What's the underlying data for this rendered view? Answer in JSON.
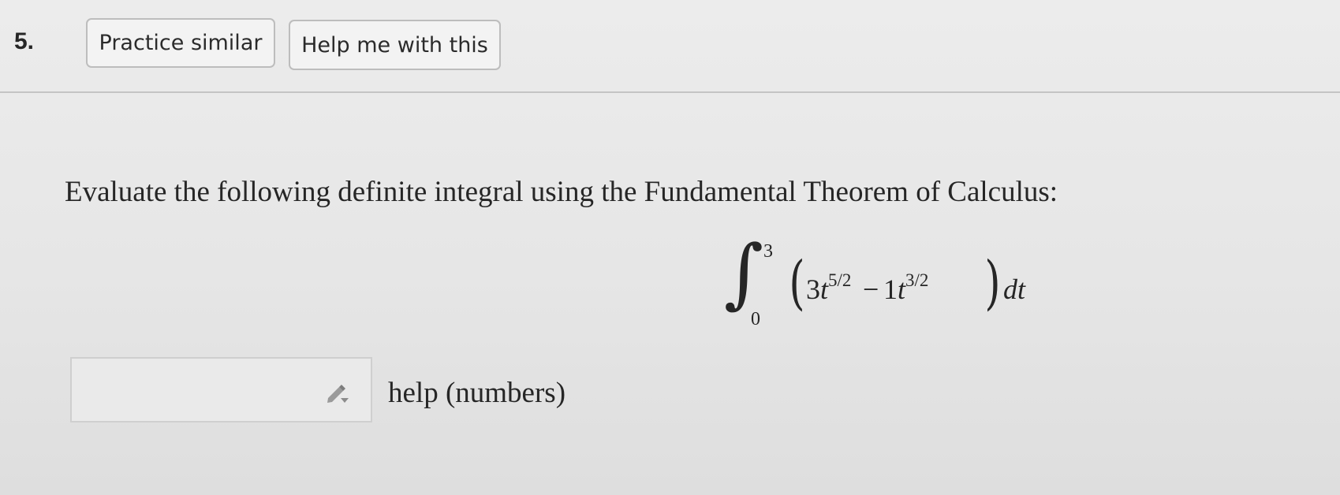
{
  "question": {
    "number": "5.",
    "buttons": {
      "practice_similar": "Practice similar",
      "help_me": "Help me with this"
    },
    "prompt": "Evaluate the following definite integral using the Fundamental Theorem of Calculus:",
    "integral": {
      "lower_limit": "0",
      "upper_limit": "3",
      "term1_coef": "3",
      "term1_var": "t",
      "term1_exp": "5/2",
      "operator": "−",
      "term2_coef": "1",
      "term2_var": "t",
      "term2_exp": "3/2",
      "differential": "dt"
    },
    "answer": {
      "value": "",
      "icon": "pencil-icon",
      "help_text": "help (numbers)"
    }
  },
  "colors": {
    "background": "#e6e6e6",
    "text": "#262626",
    "button_border": "#bdbdbd"
  }
}
